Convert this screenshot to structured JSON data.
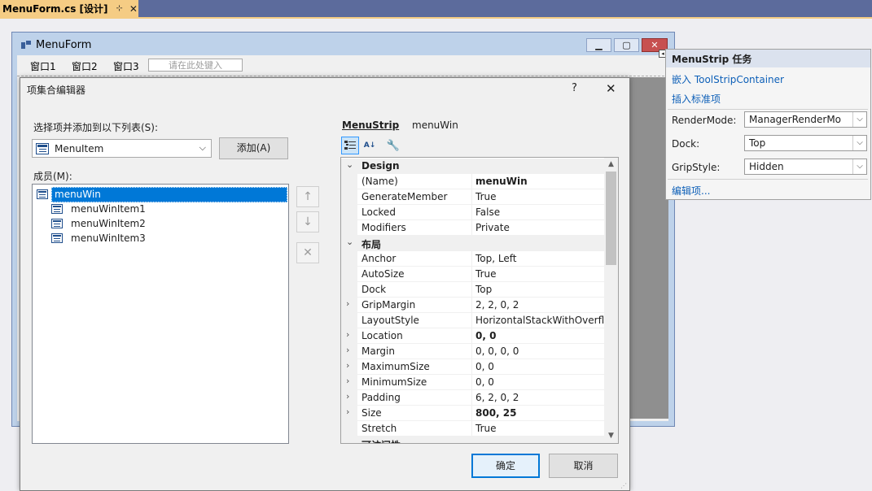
{
  "doc_tab": {
    "title": "MenuForm.cs [设计]",
    "pin": "⊹",
    "close": "✕"
  },
  "form": {
    "title": "MenuForm",
    "menu_items": [
      "窗口1",
      "窗口2",
      "窗口3"
    ],
    "type_here": "请在此处键入"
  },
  "tasks": {
    "title": "MenuStrip 任务",
    "link_embed": "嵌入 ToolStripContainer",
    "link_insert": "插入标准项",
    "rows": [
      {
        "label": "RenderMode:",
        "value": "ManagerRenderMo"
      },
      {
        "label": "Dock:",
        "value": "Top"
      },
      {
        "label": "GripStyle:",
        "value": "Hidden"
      }
    ],
    "link_edit": "编辑项..."
  },
  "dialog": {
    "title": "项集合编辑器",
    "help": "?",
    "close": "✕",
    "select_label": "选择项并添加到以下列表(S):",
    "type_value": "MenuItem",
    "add_label": "添加(A)",
    "members_label": "成员(M):",
    "members": [
      "menuWin",
      "menuWinItem1",
      "menuWinItem2",
      "menuWinItem3"
    ],
    "ok_label": "确定",
    "cancel_label": "取消"
  },
  "propgrid": {
    "object": "MenuStrip",
    "name": "menuWin",
    "rows": [
      {
        "kind": "cat",
        "name": "Design"
      },
      {
        "name": "(Name)",
        "value": "menuWin",
        "bold": true
      },
      {
        "name": "GenerateMember",
        "value": "True"
      },
      {
        "name": "Locked",
        "value": "False"
      },
      {
        "name": "Modifiers",
        "value": "Private"
      },
      {
        "kind": "cat",
        "name": "布局"
      },
      {
        "name": "Anchor",
        "value": "Top, Left"
      },
      {
        "name": "AutoSize",
        "value": "True"
      },
      {
        "name": "Dock",
        "value": "Top"
      },
      {
        "name": "GripMargin",
        "value": "2, 2, 0, 2",
        "expandable": true
      },
      {
        "name": "LayoutStyle",
        "value": "HorizontalStackWithOverflc"
      },
      {
        "name": "Location",
        "value": "0, 0",
        "expandable": true,
        "bold": true
      },
      {
        "name": "Margin",
        "value": "0, 0, 0, 0",
        "expandable": true
      },
      {
        "name": "MaximumSize",
        "value": "0, 0",
        "expandable": true
      },
      {
        "name": "MinimumSize",
        "value": "0, 0",
        "expandable": true
      },
      {
        "name": "Padding",
        "value": "6, 2, 0, 2",
        "expandable": true
      },
      {
        "name": "Size",
        "value": "800, 25",
        "expandable": true,
        "bold": true
      },
      {
        "name": "Stretch",
        "value": "True"
      },
      {
        "kind": "cat",
        "name": "可访问性"
      }
    ]
  }
}
